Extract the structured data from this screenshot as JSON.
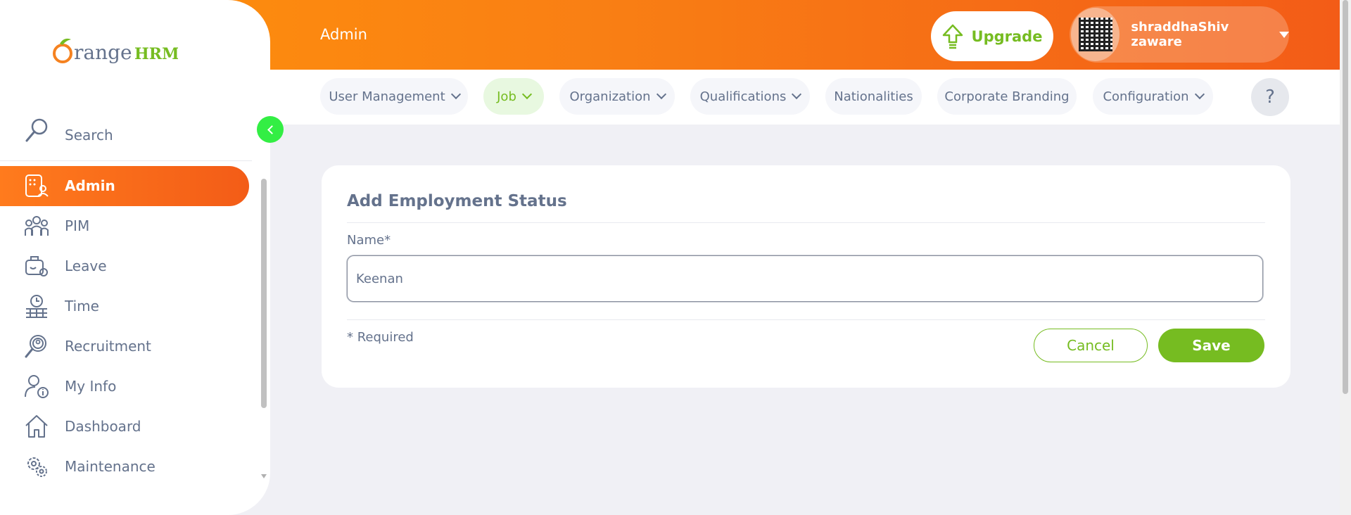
{
  "header": {
    "title": "Admin",
    "upgrade_label": "Upgrade",
    "user_name": "shraddhaShiv zaware"
  },
  "topnav": {
    "tabs": [
      {
        "label": "User Management",
        "has_dropdown": true,
        "active": false
      },
      {
        "label": "Job",
        "has_dropdown": true,
        "active": true
      },
      {
        "label": "Organization",
        "has_dropdown": true,
        "active": false
      },
      {
        "label": "Qualifications",
        "has_dropdown": true,
        "active": false
      },
      {
        "label": "Nationalities",
        "has_dropdown": false,
        "active": false
      },
      {
        "label": "Corporate Branding",
        "has_dropdown": false,
        "active": false
      },
      {
        "label": "Configuration",
        "has_dropdown": true,
        "active": false
      }
    ],
    "help_label": "?"
  },
  "sidebar": {
    "logo_text_orange": "range",
    "logo_text_green": "HRM",
    "search_placeholder": "Search",
    "items": [
      {
        "label": "Admin",
        "icon": "admin-icon",
        "active": true
      },
      {
        "label": "PIM",
        "icon": "pim-icon",
        "active": false
      },
      {
        "label": "Leave",
        "icon": "leave-icon",
        "active": false
      },
      {
        "label": "Time",
        "icon": "time-icon",
        "active": false
      },
      {
        "label": "Recruitment",
        "icon": "recruitment-icon",
        "active": false
      },
      {
        "label": "My Info",
        "icon": "my-info-icon",
        "active": false
      },
      {
        "label": "Dashboard",
        "icon": "dashboard-icon",
        "active": false
      },
      {
        "label": "Maintenance",
        "icon": "maintenance-icon",
        "active": false
      }
    ]
  },
  "form": {
    "title": "Add Employment Status",
    "name_label": "Name*",
    "name_value": "Keenan",
    "required_note": "* Required",
    "cancel_label": "Cancel",
    "save_label": "Save"
  },
  "colors": {
    "accent_orange": "#ff7b1d",
    "accent_green": "#76bc21",
    "collapse_green": "#33ee44"
  }
}
